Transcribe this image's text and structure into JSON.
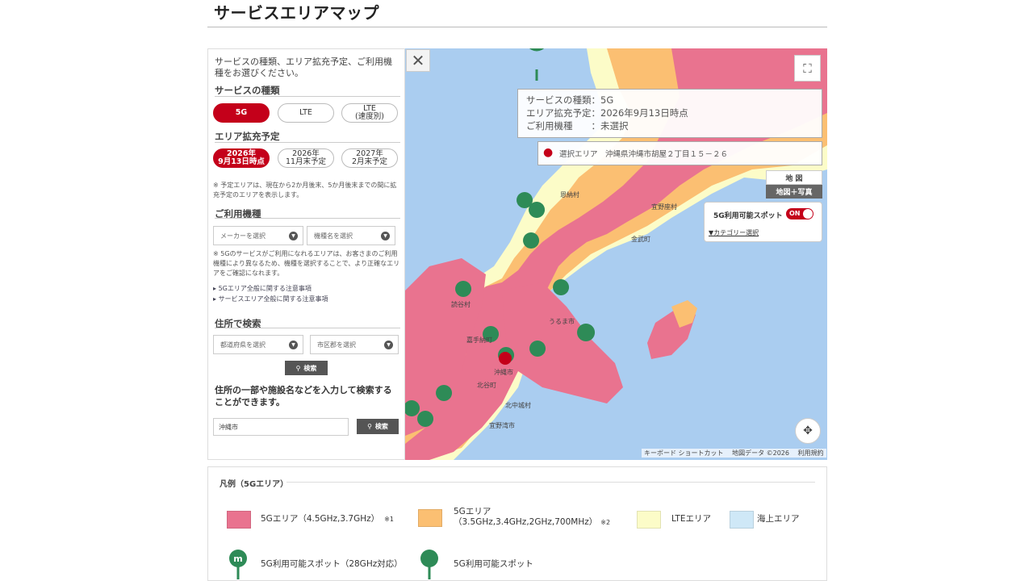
{
  "page": {
    "title": "サービスエリアマップ"
  },
  "panel": {
    "intro": "サービスの種類、エリア拡充予定、ご利用機種をお選びください。",
    "service_heading": "サービスの種類",
    "service_types": [
      {
        "label": "5G",
        "active": true
      },
      {
        "label": "LTE",
        "active": false
      },
      {
        "label": "LTE\n(速度別)",
        "active": false
      }
    ],
    "expansion_heading": "エリア拡充予定",
    "expansion_options": [
      {
        "label": "2026年\n9月13日時点",
        "active": true
      },
      {
        "label": "2026年\n11月末予定",
        "active": false
      },
      {
        "label": "2027年\n2月末予定",
        "active": false
      }
    ],
    "expansion_note": "※ 予定エリアは、現在から2か月後末、5か月後末までの間に拡充予定のエリアを表示します。",
    "device_heading": "ご利用機種",
    "maker_placeholder": "メーカーを選択",
    "model_placeholder": "機種名を選択",
    "device_note": "※ 5Gのサービスがご利用になれるエリアは、お客さまのご利用機種により異なるため、機種を選択することで、より正確なエリアをご確認になれます。",
    "links": [
      "5Gエリア全般に関する注意事項",
      "サービスエリア全般に関する注意事項"
    ],
    "address_heading": "住所で検索",
    "pref_placeholder": "都道府県を選択",
    "city_placeholder": "市区郡を選択",
    "search_label": "検索",
    "free_search_desc": "住所の一部や施設名などを入力して検索することができます。",
    "free_search_value": "沖縄市",
    "free_search_button": "検索"
  },
  "map": {
    "info": {
      "service": "サービスの種類：5G",
      "expansion": "エリア拡充予定：2026年9月13日時点",
      "device": "ご利用機種　　：未選択"
    },
    "selected_area": "選択エリア　沖縄県沖縄市胡屋２丁目１５－２６",
    "map_type": {
      "map": "地 図",
      "map_photo": "地図＋写真"
    },
    "spot_toggle": {
      "label": "5G利用可能スポット",
      "state": "ON"
    },
    "category_link": "▼カテゴリー選択",
    "place_labels": [
      "恩納村",
      "宜野座村",
      "金武町",
      "うるま市",
      "読谷村",
      "嘉手納町",
      "北谷町",
      "北中城村",
      "宜野湾市",
      "沖縄市"
    ],
    "footer": "キーボード ショートカット　 地図データ ©2026　 利用規約",
    "icons": {
      "close": "close-icon",
      "fullscreen": "fullscreen-icon",
      "locate": "locate-icon",
      "marker": "red-location-marker"
    }
  },
  "legend": {
    "title": "凡例（5Gエリア）",
    "items": [
      {
        "label": "5Gエリア（4.5GHz,3.7GHz）",
        "note": "※1",
        "color": "#e9738f"
      },
      {
        "label": "5Gエリア\n（3.5GHz,3.4GHz,2GHz,700MHz）",
        "note": "※2",
        "color": "#fbbf72"
      },
      {
        "label": "LTEエリア",
        "note": "",
        "color": "#fcfcc8"
      },
      {
        "label": "海上エリア",
        "note": "",
        "color": "#cfe8f7"
      }
    ],
    "spots": [
      {
        "label": "5G利用可能スポット（28GHz対応）",
        "icon": "pin-m-icon"
      },
      {
        "label": "5G利用可能スポット",
        "icon": "pin-icon"
      }
    ]
  },
  "colors": {
    "accent": "#c4001a",
    "pin": "#2e8b57",
    "high5g": "#e9738f",
    "mid5g": "#fbbf72",
    "lte": "#fcfcc8",
    "sea": "#aacdf0"
  }
}
